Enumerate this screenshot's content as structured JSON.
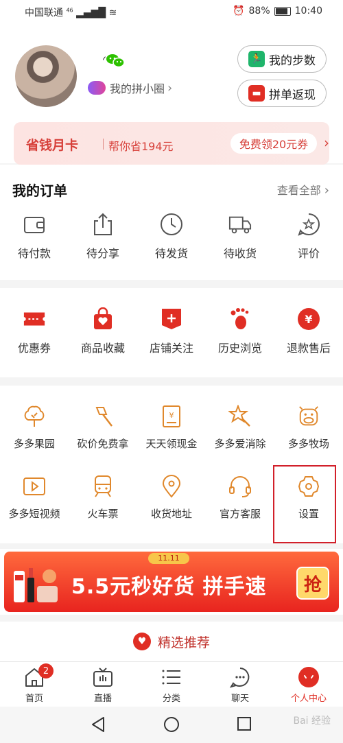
{
  "status_bar": {
    "carrier": "中国联通",
    "network": "46",
    "battery": "88%",
    "time": "10:40"
  },
  "profile": {
    "circle_link": "我的拼小圈",
    "steps_button": "我的步数",
    "rebate_button": "拼单返现"
  },
  "monthly_card": {
    "title": "省钱月卡",
    "saving_text": "帮你省194元",
    "cta": "免费领20元券"
  },
  "orders": {
    "title": "我的订单",
    "view_all": "查看全部",
    "items": [
      {
        "label": "待付款",
        "icon": "wallet-icon"
      },
      {
        "label": "待分享",
        "icon": "share-icon"
      },
      {
        "label": "待发货",
        "icon": "clock-icon"
      },
      {
        "label": "待收货",
        "icon": "truck-icon"
      },
      {
        "label": "评价",
        "icon": "review-icon"
      }
    ]
  },
  "tools": {
    "items": [
      {
        "label": "优惠券",
        "icon": "coupon-icon"
      },
      {
        "label": "商品收藏",
        "icon": "favorite-bag-icon"
      },
      {
        "label": "店铺关注",
        "icon": "store-follow-icon"
      },
      {
        "label": "历史浏览",
        "icon": "footprint-icon"
      },
      {
        "label": "退款售后",
        "icon": "refund-icon"
      }
    ]
  },
  "services": {
    "row1": [
      {
        "label": "多多果园",
        "icon": "tree-icon"
      },
      {
        "label": "砍价免费拿",
        "icon": "axe-icon"
      },
      {
        "label": "天天领现金",
        "icon": "cash-icon"
      },
      {
        "label": "多多爱消除",
        "icon": "star-wand-icon"
      },
      {
        "label": "多多牧场",
        "icon": "cow-icon"
      }
    ],
    "row2": [
      {
        "label": "多多短视频",
        "icon": "video-icon"
      },
      {
        "label": "火车票",
        "icon": "train-icon"
      },
      {
        "label": "收货地址",
        "icon": "location-icon"
      },
      {
        "label": "官方客服",
        "icon": "headset-icon"
      },
      {
        "label": "设置",
        "icon": "settings-icon"
      }
    ]
  },
  "banner": {
    "text": "5.5元秒好货 拼手速",
    "tag": "11.11",
    "button": "抢"
  },
  "recommend": {
    "label": "精选推荐"
  },
  "tab_bar": {
    "items": [
      {
        "label": "首页",
        "icon": "home-icon",
        "badge": "2"
      },
      {
        "label": "直播",
        "icon": "tv-icon"
      },
      {
        "label": "分类",
        "icon": "list-icon"
      },
      {
        "label": "聊天",
        "icon": "chat-icon"
      },
      {
        "label": "个人中心",
        "icon": "profile-icon",
        "active": true
      }
    ]
  },
  "colors": {
    "brand_red": "#e02e24",
    "service_orange": "#e0882c"
  },
  "watermark": "Bai 经验"
}
